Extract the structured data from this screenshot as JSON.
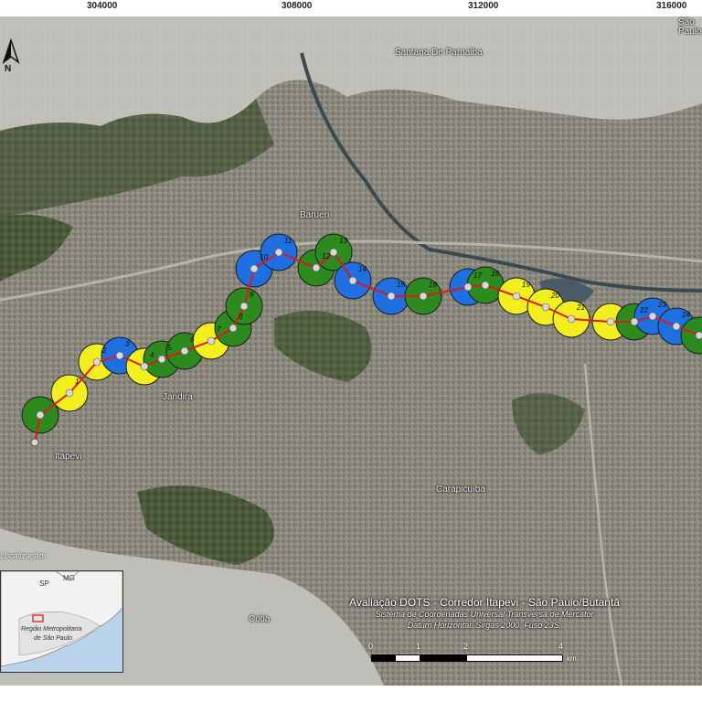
{
  "grid_labels": [
    "304000",
    "308000",
    "312000",
    "316000"
  ],
  "north_label": "N",
  "places": {
    "santana": "Santana De Parnaiba",
    "barueri": "Barueri",
    "jandira": "Jandira",
    "itapevi": "Itapevi",
    "carapicuiba": "Carapicuíba",
    "cotia": "Cotia",
    "sao_paulo": "São Paulo"
  },
  "location": {
    "title": "Localização:",
    "sp": "SP",
    "mg": "MG",
    "region_line1": "Região Metropolitana",
    "region_line2": "de São Paulo"
  },
  "credit": {
    "title": "Avaliação DOTS - Corredor Itapevi - São Paulo/Butantã",
    "line1": "Sistema de Coordenadas Universal Transversa de Mercator",
    "line2": "Datum Horizontal: Sirgas 2000. Fuso 23S."
  },
  "scale": {
    "ticks": [
      "0",
      "1",
      "2",
      "4"
    ],
    "unit": "km"
  },
  "colors": {
    "route": "#e0161b",
    "blue": "#1f6fe0",
    "green": "#2c8a1e",
    "yellow": "#f3ef1f"
  },
  "stations": [
    {
      "label": "",
      "color": "green"
    },
    {
      "label": "1",
      "color": "yellow"
    },
    {
      "label": "2",
      "color": "yellow"
    },
    {
      "label": "3",
      "color": "blue"
    },
    {
      "label": "4",
      "color": "yellow"
    },
    {
      "label": "5",
      "color": "green"
    },
    {
      "label": "6",
      "color": "green"
    },
    {
      "label": "7",
      "color": "yellow"
    },
    {
      "label": "8",
      "color": "green"
    },
    {
      "label": "9",
      "color": "green"
    },
    {
      "label": "10",
      "color": "blue"
    },
    {
      "label": "11",
      "color": "blue"
    },
    {
      "label": "12",
      "color": "green"
    },
    {
      "label": "13",
      "color": "green"
    },
    {
      "label": "14",
      "color": "blue"
    },
    {
      "label": "15",
      "color": "blue"
    },
    {
      "label": "16",
      "color": "green"
    },
    {
      "label": "17",
      "color": "blue"
    },
    {
      "label": "18",
      "color": "green"
    },
    {
      "label": "19",
      "color": "yellow"
    },
    {
      "label": "20",
      "color": "yellow"
    },
    {
      "label": "21",
      "color": "yellow"
    },
    {
      "label": "",
      "color": "yellow"
    },
    {
      "label": "22",
      "color": "green"
    },
    {
      "label": "23",
      "color": "blue"
    },
    {
      "label": "24",
      "color": "blue"
    },
    {
      "label": "25",
      "color": "green"
    }
  ]
}
